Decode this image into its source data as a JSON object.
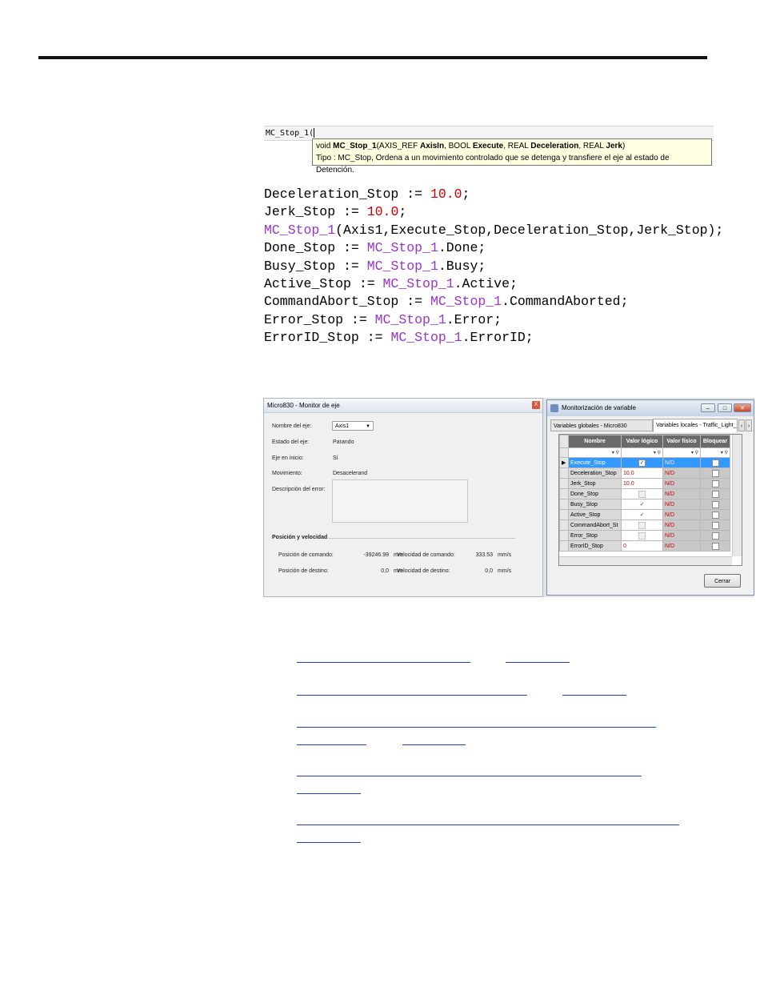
{
  "editor": {
    "line_text": "MC_Stop_1(",
    "tooltip": {
      "sig_void": "void ",
      "sig_name": "MC_Stop_1",
      "sig_p1": "(AXIS_REF ",
      "sig_b1": "AxisIn",
      "sig_p2": ", BOOL ",
      "sig_b2": "Execute",
      "sig_p3": ", REAL ",
      "sig_b3": "Deceleration",
      "sig_p4": ", REAL ",
      "sig_b4": "Jerk",
      "sig_p5": ")",
      "desc": "Tipo : MC_Stop, Ordena a un movimiento controlado que se detenga y transfiere el eje al estado de Detención."
    }
  },
  "code": {
    "l1a": "Deceleration_Stop := ",
    "l1n": "10.0",
    "l1b": ";",
    "l2a": "Jerk_Stop := ",
    "l2n": "10.0",
    "l2b": ";",
    "l3f": "MC_Stop_1",
    "l3b": "(Axis1,Execute_Stop,Deceleration_Stop,Jerk_Stop);",
    "l4a": "Done_Stop := ",
    "l4f": "MC_Stop_1",
    "l4b": ".Done;",
    "l5a": "Busy_Stop := ",
    "l5f": "MC_Stop_1",
    "l5b": ".Busy;",
    "l6a": "Active_Stop := ",
    "l6f": "MC_Stop_1",
    "l6b": ".Active;",
    "l7a": "CommandAbort_Stop := ",
    "l7f": "MC_Stop_1",
    "l7b": ".CommandAborted;",
    "l8a": "Error_Stop := ",
    "l8f": "MC_Stop_1",
    "l8b": ".Error;",
    "l9a": "ErrorID_Stop := ",
    "l9f": "MC_Stop_1",
    "l9b": ".ErrorID;"
  },
  "axis_monitor": {
    "title": "Micro830 - Monitor de eje",
    "close": "X",
    "axis_name_label": "Nombre del eje:",
    "axis_name_value": "Axis1",
    "state_label": "Estado del eje:",
    "state_value": "Parando",
    "home_label": "Eje en inicio:",
    "home_value": "Sí",
    "motion_label": "Movimiento:",
    "motion_value": "Desacelerand",
    "error_desc_label": "Descripción del error:",
    "group_title": "Posición y velocidad",
    "cmd_pos_label": "Posición de comando:",
    "cmd_pos_value": "-39246.99",
    "cmd_pos_unit": "mm",
    "cmd_vel_label": "Velocidad de comando:",
    "cmd_vel_value": "333.53",
    "cmd_vel_unit": "mm/s",
    "dest_pos_label": "Posición de destino:",
    "dest_pos_value": "0,0",
    "dest_pos_unit": "mm",
    "dest_vel_label": "Velocidad de destino:",
    "dest_vel_value": "0,0",
    "dest_vel_unit": "mm/s"
  },
  "var_monitor": {
    "title": "Monitorización de variable",
    "tab1": "Variables globales - Micro830",
    "tab2": "Variables locales - Traffic_Light_Control",
    "col_name": "Nombre",
    "col_logic": "Valor lógico",
    "col_phys": "Valor físico",
    "col_lock": "Bloquear",
    "rows": [
      {
        "name": "Execute_Stop",
        "logic": "✓",
        "phys": "N/D"
      },
      {
        "name": "Deceleration_Stop",
        "logic": "10.0",
        "phys": "N/D"
      },
      {
        "name": "Jerk_Stop",
        "logic": "10.0",
        "phys": "N/D"
      },
      {
        "name": "Done_Stop",
        "logic": "",
        "phys": "N/D"
      },
      {
        "name": "Busy_Stop",
        "logic": "✓",
        "phys": "N/D"
      },
      {
        "name": "Active_Stop",
        "logic": "✓",
        "phys": "N/D"
      },
      {
        "name": "CommandAbort_St",
        "logic": "",
        "phys": "N/D"
      },
      {
        "name": "Error_Stop",
        "logic": "",
        "phys": "N/D"
      },
      {
        "name": "ErrorID_Stop",
        "logic": "0",
        "phys": "N/D"
      }
    ],
    "close_button": "Cerrar"
  }
}
